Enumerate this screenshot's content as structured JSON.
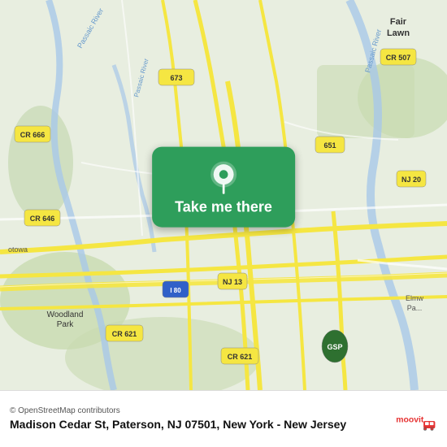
{
  "map": {
    "background_color": "#e8f0e0"
  },
  "button": {
    "label": "Take me there",
    "bg_color": "#2e9e5b"
  },
  "info_bar": {
    "copyright": "© OpenStreetMap contributors",
    "address": "Madison Cedar St, Paterson, NJ 07501, New York - New Jersey",
    "logo_text": "moovit"
  }
}
